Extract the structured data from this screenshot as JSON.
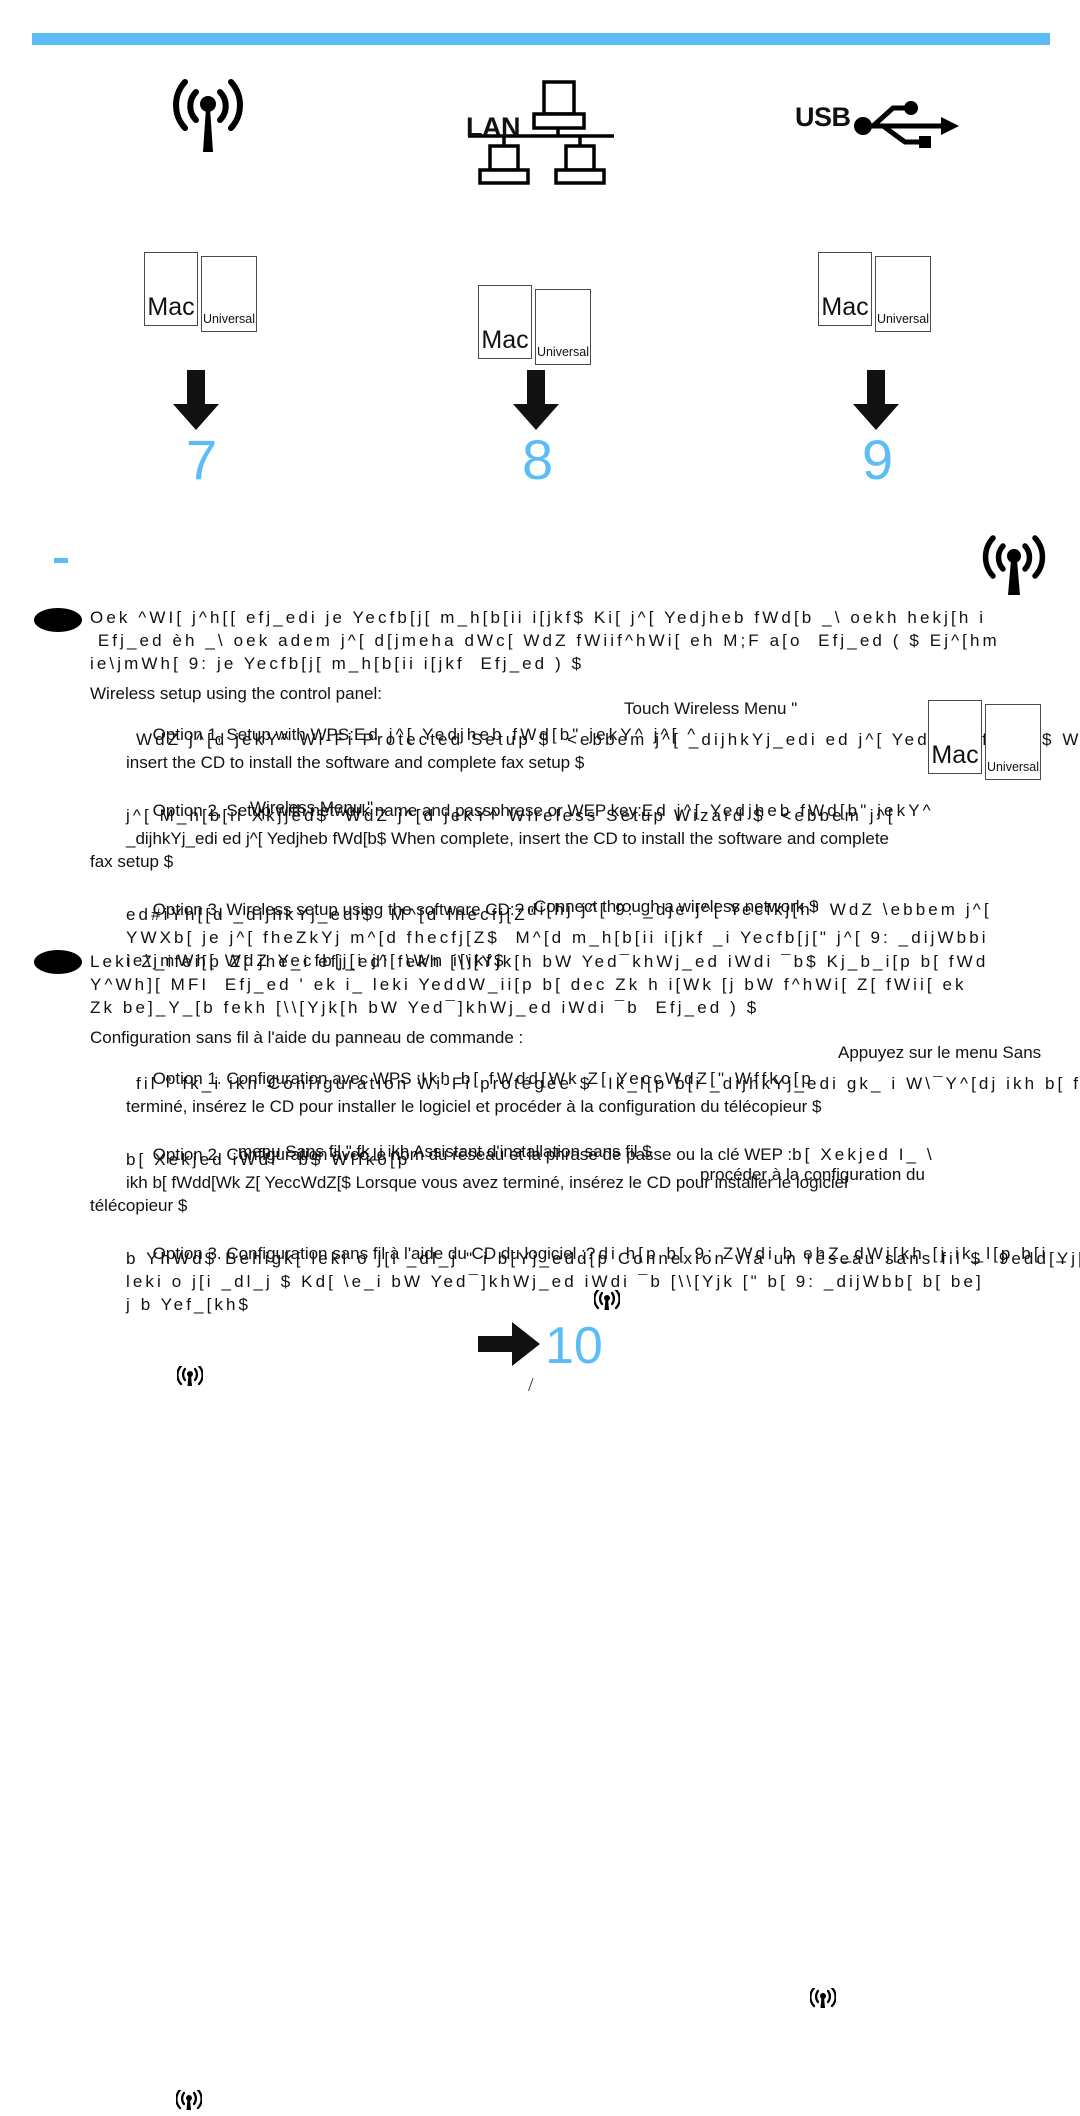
{
  "document": {
    "type": "printer-setup-guide-page",
    "language_sections": [
      "English",
      "French"
    ]
  },
  "theme": {
    "accent_blue": "#5cbcf6",
    "text_black": "#111111",
    "box_border": "#4a4a4a",
    "page_background": "#ffffff"
  },
  "connection_icons": [
    {
      "name": "wireless-icon",
      "label": ""
    },
    {
      "name": "lan-icon",
      "label": "LAN"
    },
    {
      "name": "usb-icon",
      "label": "USB"
    }
  ],
  "cd_cases": [
    {
      "primary": "Mac",
      "secondary": "Universal"
    },
    {
      "primary": "Mac",
      "secondary": "Universal"
    },
    {
      "primary": "Mac",
      "secondary": "Universal"
    },
    {
      "primary": "Mac",
      "secondary": "Universal"
    }
  ],
  "steps": [
    {
      "number": "7"
    },
    {
      "number": "8"
    },
    {
      "number": "9"
    },
    {
      "number": "10"
    }
  ],
  "slash_mark": "/",
  "english": {
    "intro": [
      "Oek ^WI[ j^h[[ efj_edi je Yecfb[j[ m_h[b[ii i[jkf$ Ki[ j^[ Yedjheb fWd[b _\\ oekh hekj[h i",
      " Efj_ed èh _\\ oek adem j^[ d[jmeha dWc[ WdZ fWiif^hWi[ eh M;F a[o  Efj_ed ( $ Ej^[hm",
      "ie\\jmWh[ 9: je Yecfb[j[ m_h[b[ii i[jkf  Efj_ed ) $"
    ],
    "heading": "Wireless setup using the control panel:",
    "options": [
      {
        "label": "Option 1, Setup with WPS:",
        "lines": [
          "Ed j^[ Yedjheb fWd[b\" jekY^ j^[ ^ ",
          "WdZ j^[d jekY^ Wi-Fi Protected Setup $  <ebbem j^[ _dijhkYj_edi ed j^[ Yedjheb fWd[b$ When co",
          "insert the CD to install the software and complete fax setup $"
        ],
        "overlaps": [
          "Touch Wireless Menu \"",
          "Wi-Fi Protected Setup $",
          "When complete,"
        ]
      },
      {
        "label": "Option 2, Setup with network name and passphrase or WEP key:",
        "lines": [
          "Ed j^[ Yedjheb fWd[b\" jekY^ ",
          "j^[ M_h[b[ii Xkjjed$  WdZ j^[d jekY^ Wireless Setup Wizard $  <ebbem j^[",
          "_dijhkYj_edi ed j^[ Yedjheb fWd[b$ When complete, insert the CD to install the software and complete",
          "fax setup $"
        ],
        "overlaps": [
          "Wireless Menu \"",
          "Wireless Setup Wizard $"
        ]
      },
      {
        "label": "Option 3, Wireless setup using the software CD:",
        "lines": [
          "?di[hj j^[ 9: _dje j^[ Yecfkj[h\" WdZ \\ebbem j^[",
          "ed#iYh[[d _dijhkYj_edi$  M^[d fhecfj[Z\" ",
          "YWXb[ je j^[ fheZkYj m^[d fhecfj[Z$  M^[d m_h[b[ii i[jkf _i Yecfb[j[\" j^[ 9: _dijWbbi",
          "ie\\jmWh[ WdZ Yecfb[j[i j^[ \\Wn i[jkf$"
        ],
        "overlaps": [
          "Connect through a wireless network $",
          "9edd[Yj j^[ KI8"
        ]
      }
    ]
  },
  "french": {
    "intro": [
      "Leki Z_ifei[p Z[ jhe_i efj_edi fekh [\\\\[Yjk[h bW Yed¯khWj_ed iWdi ¯b$ Kj_b_i[p b[ fWd",
      "Y^Wh][ MFI  Efj_ed ' ek i_ leki YeddW_ii[p b[ dec Zk h i[Wk [j bW f^hWi[ Z[ fWii[ ek",
      "Zk be]_Y_[b fekh [\\\\[Yjk[h bW Yed¯]khWj_ed iWdi ¯b  Efj_ed ) $"
    ],
    "heading": "Configuration sans fil à l'aide du panneau de commande :",
    "options": [
      {
        "label": "Option 1. Configuration avec WPS :",
        "lines": [
          "Ikh b[ fWdd[Wk Z[ YeccWdZ[\" Wffko[p  ",
          "fil \" fk_i ikh Configuration Wi-Fi protégée $  Ik_l[p b[i _dijhkYj_edi gk_ i W\\¯Y^[dj ikh b[ fWdd[W",
          "terminé, insérez le CD pour installer le logiciel et procéder à la configuration du télécopieur $"
        ],
        "overlaps": [
          "Appuyez sur le menu Sans",
          "$ Appuyez sur le menu Sans ¯b"
        ]
      },
      {
        "label": "Option 2. Configuration avec le nom du réseau et la phrase de passe ou la clé WEP :",
        "lines": [
          "b[ Xekjed I_ \\ ",
          "b[ Xekjed iWdi ¯b$ Wffko[p  ",
          "ikh b[ fWdd[Wk Z[ YeccWdZ[$ Lorsque vous avez terminé, insérez le CD pour installer le logiciel",
          "télécopieur $"
        ],
        "overlaps": [
          "menu Sans fil \" fk_i ikh Assistant d'installation sans fil $",
          "procéder à la configuration du"
        ]
      },
      {
        "label": "Option 3. Configuration sans fil à l'aide du CD du logiciel :",
        "lines": [
          "?di h[p b[ 9: ZWdi b ehZ_dWj[kh [j ik_l[p b[i _",
          "b YhWd$ Behigk[ leki o j[i _dl_j \" i b[Yj_edd[p Connexion via un réseau sans fil $  9edd[Yj[p b[",
          "leki o j[i _dl_j $ Kd[ \\e_i bW Yed¯]khWj_ed iWdi ¯b [\\\\[Yjk [\" b[ 9: _dijWbb[ b[ be]",
          "j b Yef_[kh$"
        ],
        "overlaps": [
          "Connexion via un réseau sans fil $"
        ]
      }
    ]
  }
}
